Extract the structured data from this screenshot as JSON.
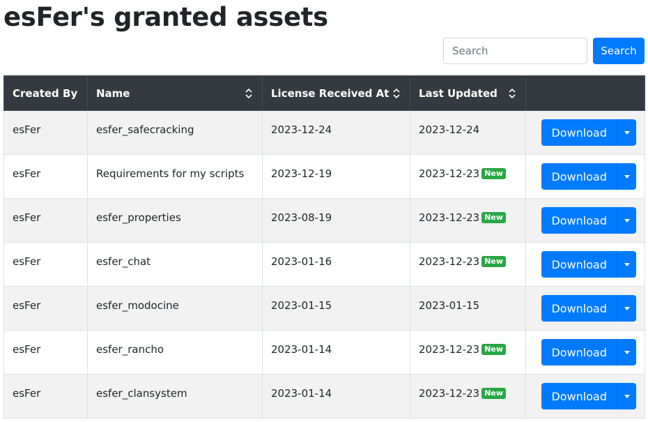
{
  "page": {
    "title": "esFer's granted assets"
  },
  "search": {
    "placeholder": "Search",
    "button_label": "Search"
  },
  "table": {
    "headers": [
      "Created By",
      "Name",
      "License Received At",
      "Last Updated",
      ""
    ],
    "download_label": "Download",
    "new_badge_label": "New",
    "rows": [
      {
        "created_by": "esFer",
        "name": "esfer_safecracking",
        "license_received_at": "2023-12-24",
        "last_updated": "2023-12-24",
        "is_new": false
      },
      {
        "created_by": "esFer",
        "name": "Requirements for my scripts",
        "license_received_at": "2023-12-19",
        "last_updated": "2023-12-23",
        "is_new": true
      },
      {
        "created_by": "esFer",
        "name": "esfer_properties",
        "license_received_at": "2023-08-19",
        "last_updated": "2023-12-23",
        "is_new": true
      },
      {
        "created_by": "esFer",
        "name": "esfer_chat",
        "license_received_at": "2023-01-16",
        "last_updated": "2023-12-23",
        "is_new": true
      },
      {
        "created_by": "esFer",
        "name": "esfer_modocine",
        "license_received_at": "2023-01-15",
        "last_updated": "2023-01-15",
        "is_new": false
      },
      {
        "created_by": "esFer",
        "name": "esfer_rancho",
        "license_received_at": "2023-01-14",
        "last_updated": "2023-12-23",
        "is_new": true
      },
      {
        "created_by": "esFer",
        "name": "esfer_clansystem",
        "license_received_at": "2023-01-14",
        "last_updated": "2023-12-23",
        "is_new": true
      }
    ]
  },
  "colors": {
    "primary": "#007bff",
    "header_bg": "#343a40",
    "badge_success": "#28a745",
    "stripe": "#f2f2f2"
  },
  "icons": {
    "sort": "sort-icon",
    "dropdown": "caret-down-icon"
  }
}
